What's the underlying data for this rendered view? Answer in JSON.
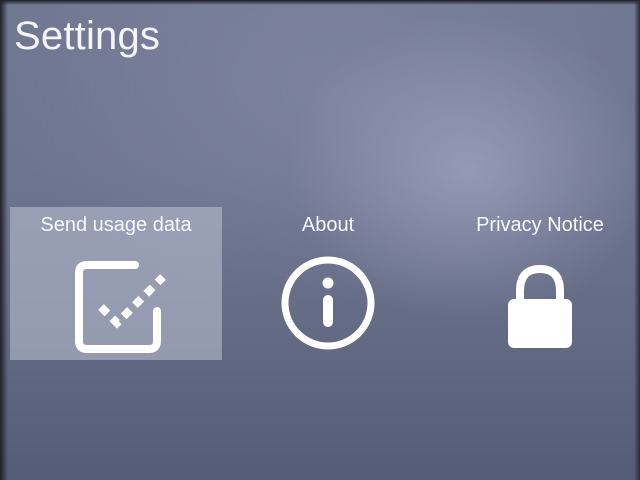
{
  "header": {
    "title": "Settings"
  },
  "tiles": [
    {
      "label": "Send usage data",
      "icon": "checkbox-dashed-check-icon",
      "focused": true
    },
    {
      "label": "About",
      "icon": "info-icon",
      "focused": false
    },
    {
      "label": "Privacy Notice",
      "icon": "lock-icon",
      "focused": false
    }
  ],
  "colors": {
    "background": "#6e7590",
    "focus_highlight": "#b4b9cb",
    "text": "#ffffff"
  }
}
